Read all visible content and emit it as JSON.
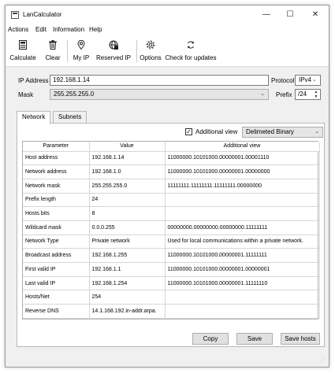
{
  "window": {
    "title": "LanCalculator",
    "controls": {
      "minimize": "—",
      "maximize": "☐",
      "close": "✕"
    }
  },
  "menu": [
    "Actions",
    "Edit",
    "Information",
    "Help"
  ],
  "toolbar": {
    "calculate": "Calculate",
    "clear": "Clear",
    "my_ip": "My IP",
    "reserved_ip": "Reserved IP",
    "options": "Options",
    "check_updates": "Check for updates",
    "icons": {
      "calculate": "calculator-icon",
      "clear": "trash-icon",
      "my_ip": "location-pin-icon",
      "reserved_ip": "globe-icon",
      "options": "gear-icon",
      "check_updates": "refresh-icon"
    }
  },
  "form": {
    "ip_label": "IP Address",
    "ip_value": "192.168.1.14",
    "protocol_label": "Protocol",
    "protocol_value": "IPv4",
    "mask_label": "Mask",
    "mask_value": "255.255.255.0",
    "prefix_label": "Prefix",
    "prefix_value": "/24"
  },
  "tabs": [
    "Network",
    "Subnets"
  ],
  "additional": {
    "checkbox_label": "Additional view",
    "checked": true,
    "format_value": "Delimeted Binary"
  },
  "table": {
    "headers": [
      "Parameter",
      "Value",
      "Additional view"
    ],
    "rows": [
      [
        "Host address",
        "192.168.1.14",
        "11000000.10101000.00000001.00001110"
      ],
      [
        "Network address",
        "192.168.1.0",
        "11000000.10101000.00000001.00000000"
      ],
      [
        "Network mask",
        "255.255.255.0",
        "11111111.11111111.11111111.00000000"
      ],
      [
        "Prefix length",
        "24",
        ""
      ],
      [
        "Hosts bits",
        "8",
        ""
      ],
      [
        "Wildcard mask",
        "0.0.0.255",
        "00000000.00000000.00000000.11111111"
      ],
      [
        "Network Type",
        "Private network",
        "Used for local communications within a private network."
      ],
      [
        "Broadcast address",
        "192.168.1.255",
        "11000000.10101000.00000001.11111111"
      ],
      [
        "First valid IP",
        "192.168.1.1",
        "11000000.10101000.00000001.00000001"
      ],
      [
        "Last valid IP",
        "192.168.1.254",
        "11000000.10101000.00000001.11111110"
      ],
      [
        "Hosts/Net",
        "254",
        ""
      ],
      [
        "Reverse DNS",
        "14.1.168.192.in-addr.arpa.",
        ""
      ]
    ]
  },
  "buttons": {
    "copy": "Copy",
    "save": "Save",
    "save_hosts": "Save hosts"
  }
}
